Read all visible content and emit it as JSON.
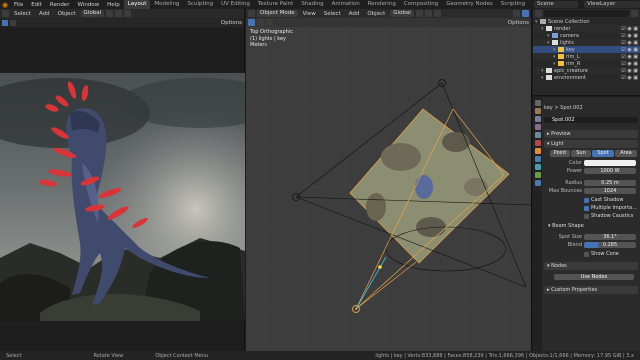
{
  "topbar": {
    "menus": [
      "File",
      "Edit",
      "Render",
      "Window",
      "Help"
    ],
    "workspaces": [
      "Layout",
      "Modeling",
      "Sculpting",
      "UV Editing",
      "Texture Paint",
      "Shading",
      "Animation",
      "Rendering",
      "Compositing",
      "Geometry Nodes",
      "Scripting"
    ],
    "active_workspace": "Layout",
    "scene": "Scene",
    "view_layer": "ViewLayer"
  },
  "render_editor": {
    "menus": [
      "Select",
      "Add",
      "Object"
    ],
    "orientation": "Global",
    "options": "Options"
  },
  "viewport": {
    "mode": "Object Mode",
    "menus": [
      "View",
      "Select",
      "Add",
      "Object"
    ],
    "orientation": "Global",
    "options": "Options",
    "info_line1": "Top Orthographic",
    "info_line2": "(1) lights | key",
    "info_line3": "Meters"
  },
  "outliner": {
    "search_placeholder": "",
    "items": [
      {
        "label": "Scene Collection",
        "depth": 0,
        "color": "#aaaaaa",
        "selected": false
      },
      {
        "label": "render",
        "depth": 1,
        "color": "#dddddd",
        "selected": false
      },
      {
        "label": "camera",
        "depth": 2,
        "color": "#7f9fd8",
        "selected": false
      },
      {
        "label": "lights",
        "depth": 2,
        "color": "#dddddd",
        "selected": false
      },
      {
        "label": "key",
        "depth": 3,
        "color": "#f0c040",
        "selected": true
      },
      {
        "label": "rim_L",
        "depth": 3,
        "color": "#f0c040",
        "selected": false
      },
      {
        "label": "rim_R",
        "depth": 3,
        "color": "#f0c040",
        "selected": false
      },
      {
        "label": "epic_creature",
        "depth": 1,
        "color": "#dddddd",
        "selected": false
      },
      {
        "label": "environment",
        "depth": 1,
        "color": "#dddddd",
        "selected": false
      }
    ]
  },
  "properties": {
    "breadcrumb_obj": "key",
    "breadcrumb_data": "Spot.002",
    "data_name": "Spot.002",
    "preview": "Preview",
    "light": "Light",
    "light_types": [
      "Point",
      "Sun",
      "Spot",
      "Area"
    ],
    "active_type": "Spot",
    "color_label": "Color",
    "power_label": "Power",
    "power_value": "1000 W",
    "radius_label": "Radius",
    "radius_value": "0.25 m",
    "max_bounces_label": "Max Bounces",
    "max_bounces_value": "1024",
    "cast_shadow": "Cast Shadow",
    "multiple_importance": "Multiple Importa...",
    "shadow_caustics": "Shadow Caustics",
    "beam_shape": "Beam Shape",
    "spot_size_label": "Spot Size",
    "spot_size_value": "36.1°",
    "blend_label": "Blend",
    "blend_value": "0.285",
    "show_cone": "Show Cone",
    "nodes": "Nodes",
    "use_nodes": "Use Nodes",
    "custom_properties": "Custom Properties"
  },
  "status": {
    "left": "Select",
    "mid": "Rotate View",
    "ctx": "Object Context Menu",
    "stats": "lights | key | Verts:833,888 | Faces:858,239 | Tris:1,666,396 | Objects:1/1,666 | Memory: 17.95 GiB | 3.x"
  }
}
